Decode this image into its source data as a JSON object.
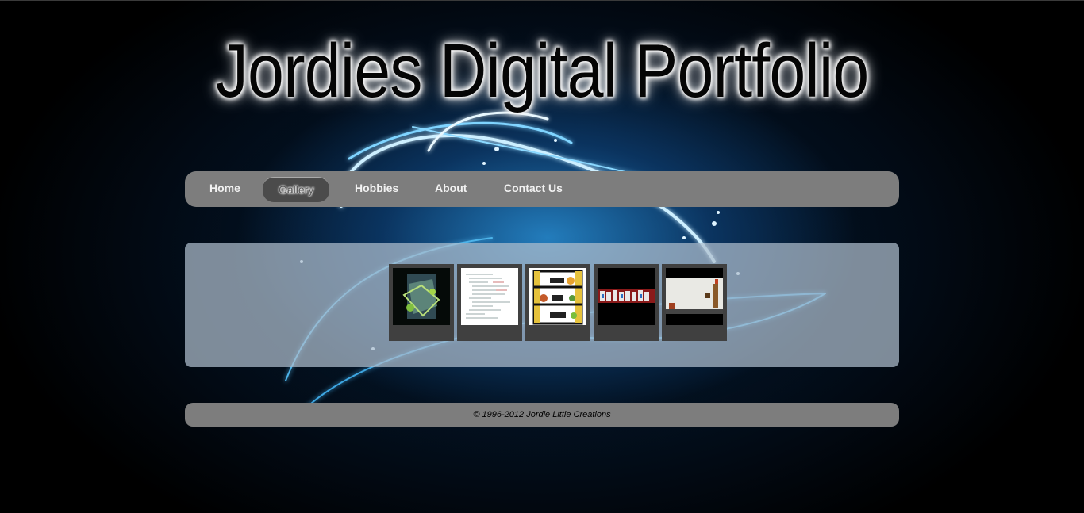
{
  "site": {
    "title": "Jordies Digital Portfolio"
  },
  "nav": {
    "items": [
      {
        "label": "Home"
      },
      {
        "label": "Gallery",
        "active": true
      },
      {
        "label": "Hobbies"
      },
      {
        "label": "About"
      },
      {
        "label": "Contact Us"
      }
    ]
  },
  "gallery": {
    "thumbnails": [
      {
        "name": "gallery-thumb-1",
        "description_icon": "dark-cube-artwork"
      },
      {
        "name": "gallery-thumb-2",
        "description_icon": "code-document"
      },
      {
        "name": "gallery-thumb-3",
        "description_icon": "cartoon-shelf-menu"
      },
      {
        "name": "gallery-thumb-4",
        "description_icon": "graffiti-banner"
      },
      {
        "name": "gallery-thumb-5",
        "description_icon": "game-screenshot"
      }
    ]
  },
  "footer": {
    "text": "© 1996-2012 Jordie Little Creations"
  },
  "colors": {
    "bar": "#7d7d7d",
    "active_tab": "#4b4b4b",
    "thumb_frame": "#404040",
    "glow": "#5fc8ff"
  }
}
